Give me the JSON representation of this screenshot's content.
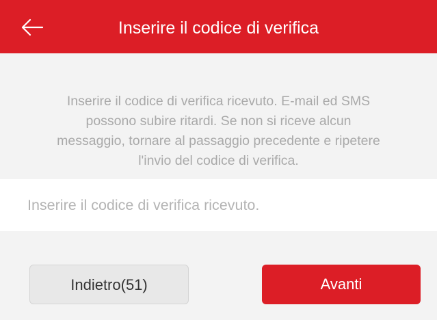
{
  "header": {
    "title": "Inserire il codice di verifica",
    "back_icon": "arrow-left-icon",
    "background_color": "#dc1e26"
  },
  "info": {
    "lines": [
      "Inserire il codice di verifica ricevuto. E-mail ed SMS",
      "possono subire ritardi. Se non si riceve alcun",
      "messaggio, tornare al passaggio precedente e ripetere",
      "l'invio del codice di verifica."
    ]
  },
  "code_input": {
    "value": "",
    "placeholder": "Inserire il codice di verifica ricevuto."
  },
  "buttons": {
    "back_label": "Indietro(51)",
    "next_label": "Avanti",
    "next_color": "#dc1e26"
  }
}
